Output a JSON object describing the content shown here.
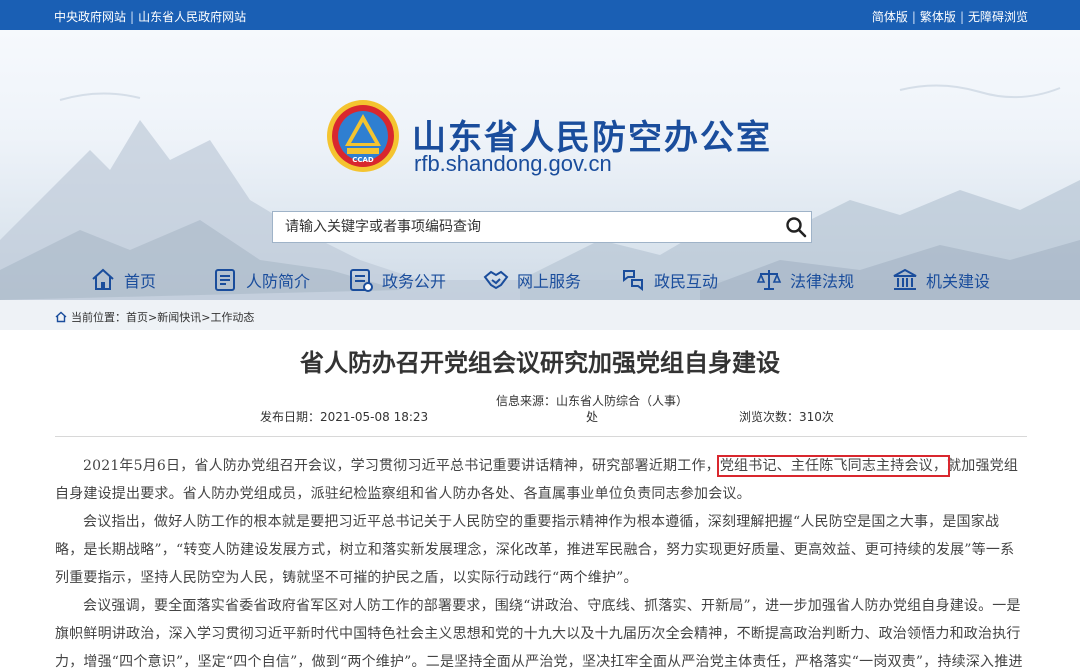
{
  "topbar": {
    "links_left": [
      "中央政府网站",
      "山东省人民政府网站"
    ],
    "links_right": [
      "简体版",
      "繁体版",
      "无障碍浏览"
    ],
    "separator": "|"
  },
  "header": {
    "title": "山东省人民防空办公室",
    "url": "rfb.shandong.gov.cn",
    "logo_text": "CCAD"
  },
  "search": {
    "placeholder": "请输入关键字或者事项编码查询"
  },
  "nav": {
    "items": [
      {
        "label": "首页",
        "icon": "home-icon"
      },
      {
        "label": "人防简介",
        "icon": "document-icon"
      },
      {
        "label": "政务公开",
        "icon": "list-icon"
      },
      {
        "label": "网上服务",
        "icon": "handshake-icon"
      },
      {
        "label": "政民互动",
        "icon": "interaction-icon"
      },
      {
        "label": "法律法规",
        "icon": "scales-icon"
      },
      {
        "label": "机关建设",
        "icon": "building-icon"
      }
    ]
  },
  "breadcrumb": {
    "prefix": "当前位置：",
    "items": [
      "首页",
      "新闻快讯",
      "工作动态"
    ],
    "separator": ">"
  },
  "article": {
    "title": "省人防办召开党组会议研究加强党组自身建设",
    "date_label": "发布日期：",
    "date": "2021-05-08 18:23",
    "source_label": "信息来源：",
    "source": "山东省人防综合（人事）处",
    "views_label": "浏览次数：",
    "views": "310次",
    "p1a": "2021年5月6日，省人防办党组召开会议，学习贯彻习近平总书记重要讲话精神，研究部署近期工作，",
    "p1_highlight": "党组书记、主任陈飞同志主持会议，",
    "p1b": "就加强党组自身建设提出要求。省人防办党组成员，派驻纪检监察组和省人防办各处、各直属事业单位负责同志参加会议。",
    "p2": "会议指出，做好人防工作的根本就是要把习近平总书记关于人民防空的重要指示精神作为根本遵循，深刻理解把握“人民防空是国之大事，是国家战略，是长期战略”，“转变人防建设发展方式，树立和落实新发展理念，深化改革，推进军民融合，努力实现更好质量、更高效益、更可持续的发展”等一系列重要指示，坚持人民防空为人民，铸就坚不可摧的护民之盾，以实际行动践行“两个维护”。",
    "p3": "会议强调，要全面落实省委省政府省军区对人防工作的部署要求，围绕“讲政治、守底线、抓落实、开新局”，进一步加强省人防办党组自身建设。一是旗帜鲜明讲政治，深入学习贯彻习近平新时代中国特色社会主义思想和党的十九大以及十九届历次全会精神，不断提高政治判断力、政治领悟力和政治执行力，增强“四个意识”，坚定“四个自信”，做到“两个维护”。二是坚持全面从严治党，坚决扛牢全面从严治党主体责任，严格落实“一岗双责”，持续深入推进人防系统专项治理，紧盯问题整改，深化标本兼治，建立长效机制，巩固治理成果，全力支持派驻纪检监察组工作，营造"
  }
}
